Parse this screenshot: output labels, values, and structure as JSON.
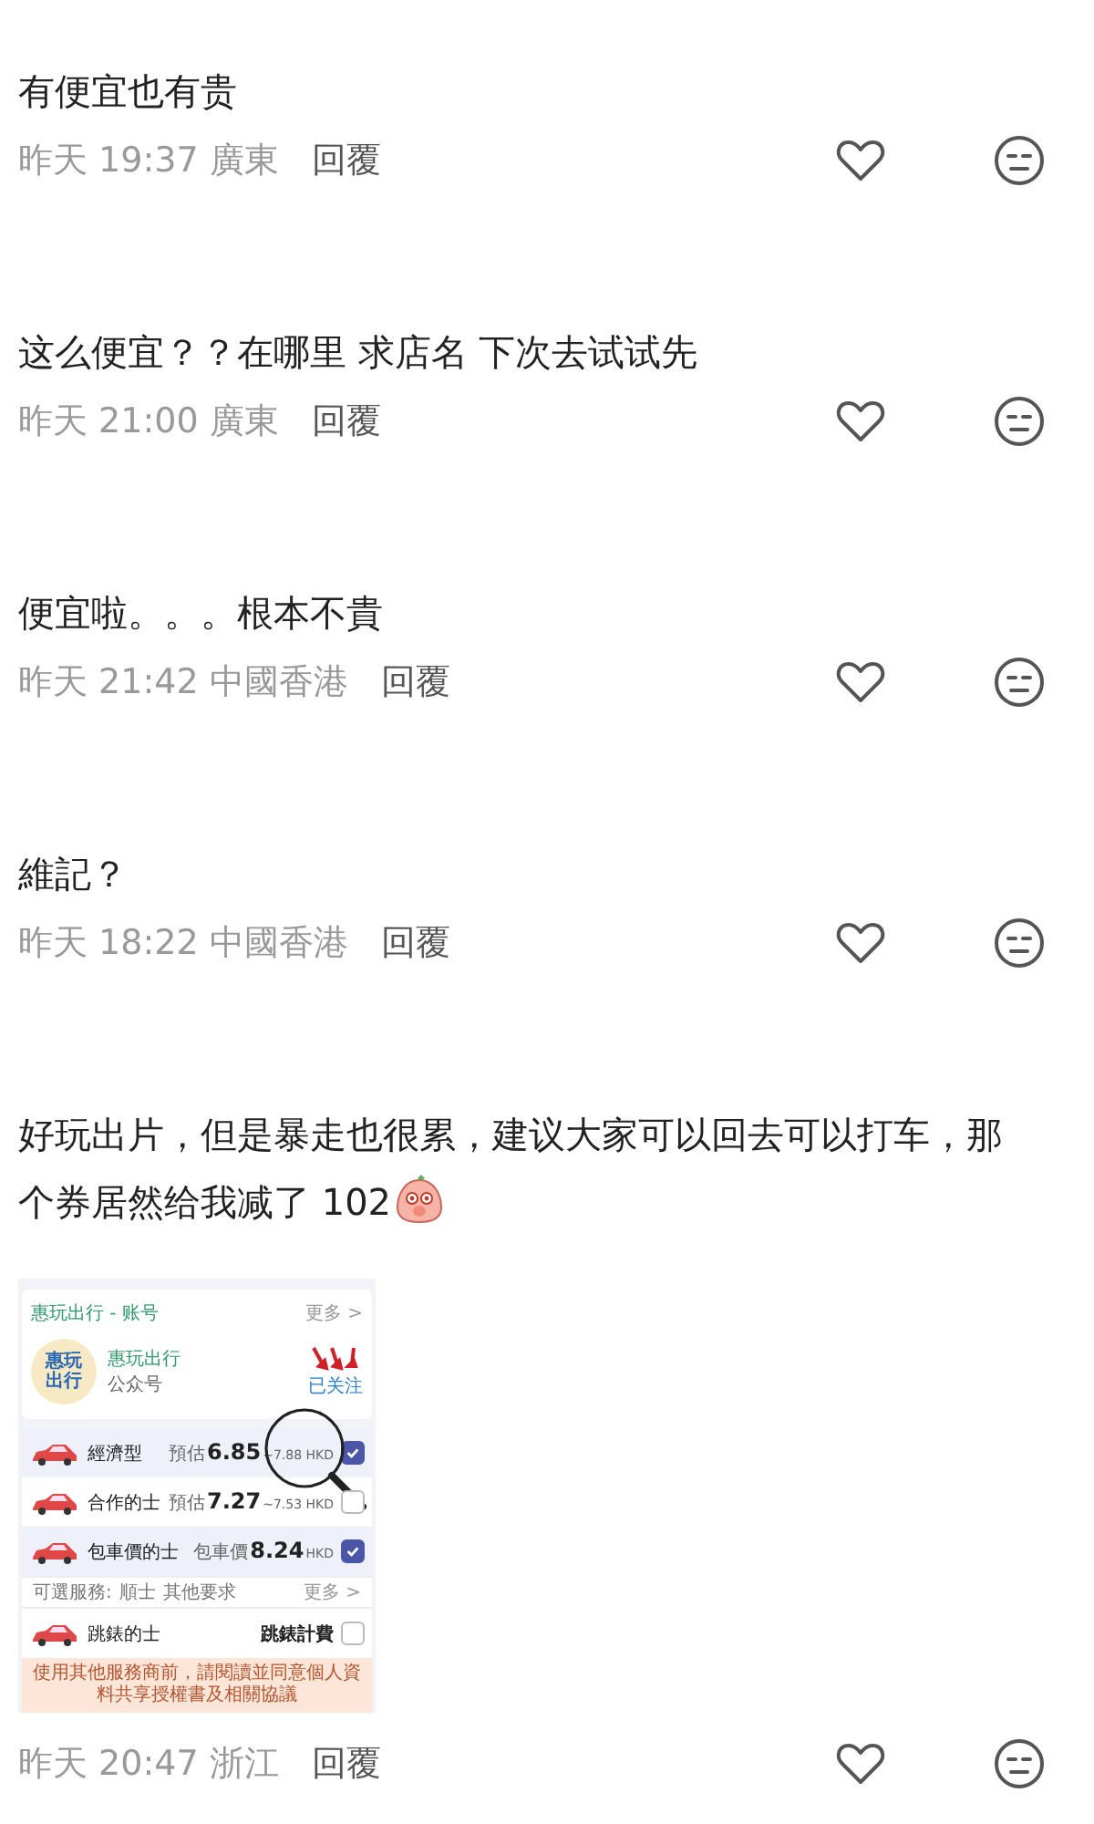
{
  "comments": [
    {
      "text": "有便宜也有贵",
      "time": "昨天 19:37",
      "location": "廣東",
      "reply": "回覆"
    },
    {
      "text": "这么便宜？？在哪里  求店名 下次去试试先",
      "time": "昨天 21:00",
      "location": "廣東",
      "reply": "回覆"
    },
    {
      "text": "便宜啦。。。根本不貴",
      "time": "昨天 21:42",
      "location": "中國香港",
      "reply": "回覆"
    },
    {
      "text": "維記？",
      "time": "昨天 18:22",
      "location": "中國香港",
      "reply": "回覆"
    },
    {
      "text": "好玩出片，但是暴走也很累，建议大家可以回去可以打车，那个券居然给我减了 102",
      "sticker": true,
      "time": "昨天 20:47",
      "location": "浙江",
      "reply": "回覆",
      "attachment": {
        "header": {
          "title": "惠玩出行 - 账号",
          "more": "更多 >"
        },
        "account": {
          "logo": [
            "惠玩",
            "出行"
          ],
          "name": "惠玩出行",
          "type": "公众号",
          "status": "已关注"
        },
        "options": [
          {
            "kind": "car",
            "name": "經濟型",
            "price_label": "預估",
            "price": "6.85",
            "price_suffix": "~7.88 HKD",
            "checked": true,
            "magnified": true
          },
          {
            "kind": "car",
            "name": "合作的士",
            "price_label": "預估",
            "price": "7.27",
            "price_suffix": "~7.53 HKD",
            "checked": false
          },
          {
            "kind": "car",
            "name": "包車價的士",
            "price_label": "包車價",
            "price": "8.24",
            "price_suffix": "HKD",
            "checked": true
          },
          {
            "kind": "services",
            "label": "可選服務:",
            "items": [
              "順士",
              "其他要求"
            ],
            "more": "更多 >"
          },
          {
            "kind": "car",
            "name": "跳錶的士",
            "price": "跳錶計費",
            "checked": false
          }
        ],
        "notice": "使用其他服務商前，請閱讀並同意個人資料共享授權書及相關協議"
      }
    }
  ]
}
